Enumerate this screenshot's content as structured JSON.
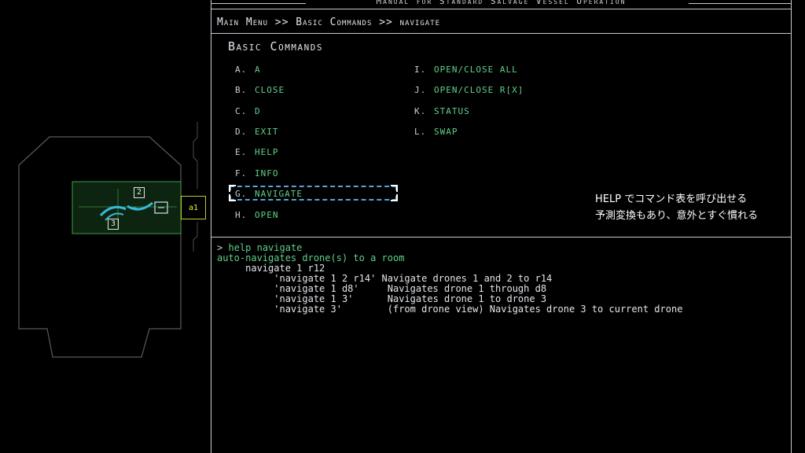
{
  "manual_title": "Manual for Standard Salvage Vessel Operation",
  "breadcrumb": "Main Menu >> Basic Commands >> navigate",
  "section_title": "Basic Commands",
  "commands_left": [
    {
      "letter": "A.",
      "name": "a"
    },
    {
      "letter": "B.",
      "name": "close"
    },
    {
      "letter": "C.",
      "name": "d"
    },
    {
      "letter": "D.",
      "name": "exit"
    },
    {
      "letter": "E.",
      "name": "help"
    },
    {
      "letter": "F.",
      "name": "info"
    },
    {
      "letter": "G.",
      "name": "navigate"
    },
    {
      "letter": "H.",
      "name": "open"
    }
  ],
  "commands_right": [
    {
      "letter": "I.",
      "name": "open/close all"
    },
    {
      "letter": "J.",
      "name": "open/close r[x]"
    },
    {
      "letter": "K.",
      "name": "status"
    },
    {
      "letter": "L.",
      "name": "swap"
    }
  ],
  "selected_command": "navigate",
  "console": {
    "prompt": ">",
    "input": "help navigate",
    "description": "auto-navigates drone(s) to a room",
    "syntax": "navigate 1 r12",
    "examples": [
      {
        "cmd": "'navigate 1 2 r14'",
        "desc": "Navigate drones 1 and 2 to r14"
      },
      {
        "cmd": "'navigate 1 d8'",
        "desc": "Navigates drone 1 through d8"
      },
      {
        "cmd": "'navigate 1 3'",
        "desc": "Navigates drone 1 to drone 3"
      },
      {
        "cmd": "'navigate 3'",
        "desc": "(from drone view) Navigates drone 3 to current drone"
      }
    ]
  },
  "map": {
    "drone_labels": [
      "2",
      "3"
    ],
    "door_label": "a1"
  },
  "caption": {
    "line1": "HELP でコマンド表を呼び出せる",
    "line2": "予測変換もあり、意外とすぐ慣れる"
  },
  "colors": {
    "command_green": "#5fd08a",
    "selection_blue": "#5aa4d6",
    "drone_cyan": "#39b8d8",
    "room_green": "#3aa04a",
    "door_yellow": "#e8e84a"
  }
}
